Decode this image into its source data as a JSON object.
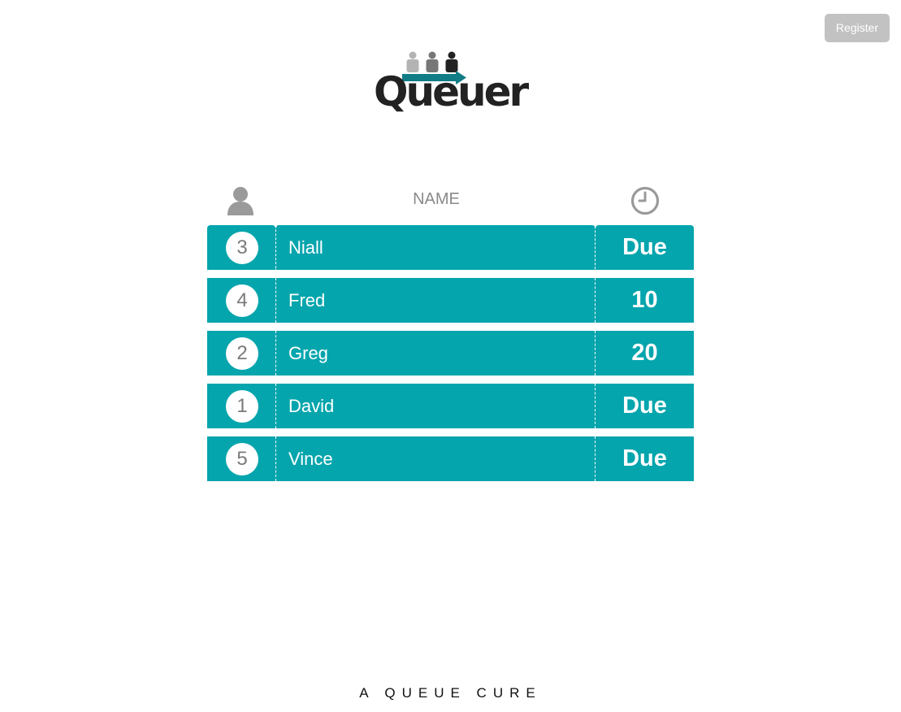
{
  "header": {
    "register_label": "Register"
  },
  "logo": {
    "text": "Queuer",
    "icon": "people-queue-arrow-icon"
  },
  "table": {
    "name_header": "NAME",
    "position_icon": "person-icon",
    "time_icon": "clock-icon",
    "rows": [
      {
        "number": "3",
        "name": "Niall",
        "time": "Due"
      },
      {
        "number": "4",
        "name": "Fred",
        "time": "10"
      },
      {
        "number": "2",
        "name": "Greg",
        "time": "20"
      },
      {
        "number": "1",
        "name": "David",
        "time": "Due"
      },
      {
        "number": "5",
        "name": "Vince",
        "time": "Due"
      }
    ]
  },
  "footer": {
    "tagline": "A QUEUE CURE"
  },
  "colors": {
    "row_bg": "#05a5ad",
    "register_bg": "#c2c2c2",
    "logo_text": "#222222"
  }
}
